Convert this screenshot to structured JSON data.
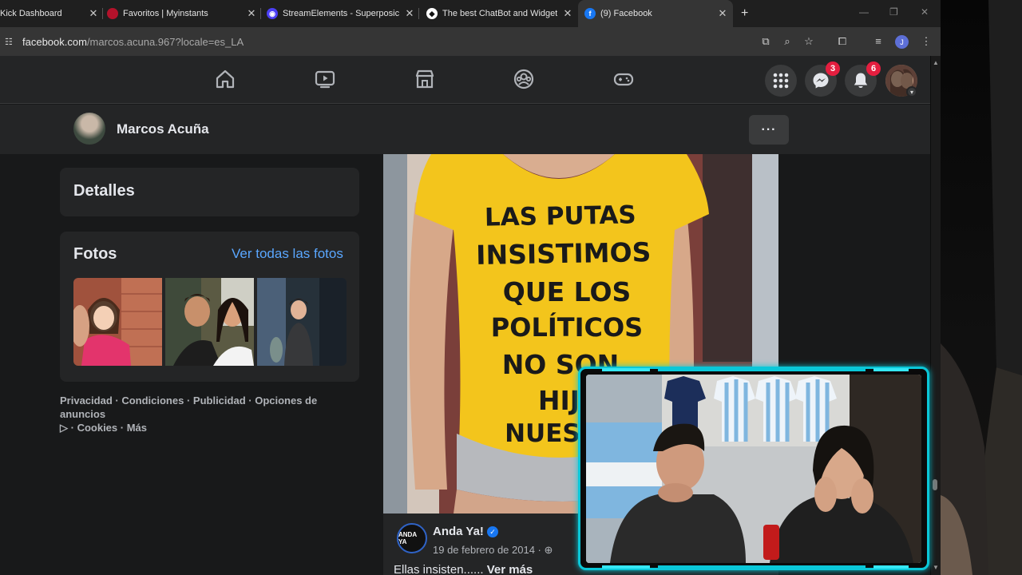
{
  "browser": {
    "tabs": [
      {
        "title": "Kick Dashboard",
        "active": false
      },
      {
        "title": "Favoritos | Myinstants",
        "active": false
      },
      {
        "title": "StreamElements - Superposicio",
        "active": false
      },
      {
        "title": "The best ChatBot and Widgets",
        "active": false
      },
      {
        "title": "(9) Facebook",
        "active": true
      }
    ],
    "new_tab_icon": "plus-icon",
    "url_host": "facebook.com",
    "url_path": "/marcos.acuna.967?locale=es_LA",
    "profile_initial": "J"
  },
  "fb_nav": {
    "messenger_badge": "3",
    "notifications_badge": "6"
  },
  "profile": {
    "name": "Marcos Acuña",
    "more_label": "···"
  },
  "details": {
    "title": "Detalles"
  },
  "photos": {
    "title": "Fotos",
    "see_all": "Ver todas las fotos"
  },
  "footer": {
    "privacy": "Privacidad",
    "terms": "Condiciones",
    "ads": "Publicidad",
    "ad_choices": "Opciones de anuncios",
    "cookies": "Cookies",
    "more": "Más",
    "sep": " · "
  },
  "post": {
    "shirt_lines": [
      "LAS PUTAS",
      "INSISTIMOS",
      "QUE LOS",
      "POLÍTICOS",
      "NO SON",
      "HIJ",
      "NUEST"
    ],
    "author": "Anda Ya!",
    "author_avatar_text": "ANDA YA",
    "date": "19 de febrero de 2014",
    "text": "Ellas insisten......",
    "see_more": "Ver más"
  },
  "colors": {
    "accent_link": "#5aa7ff",
    "badge": "#e41e3f",
    "webcam_border": "#0ac7d8",
    "shirt": "#f3c51c"
  }
}
